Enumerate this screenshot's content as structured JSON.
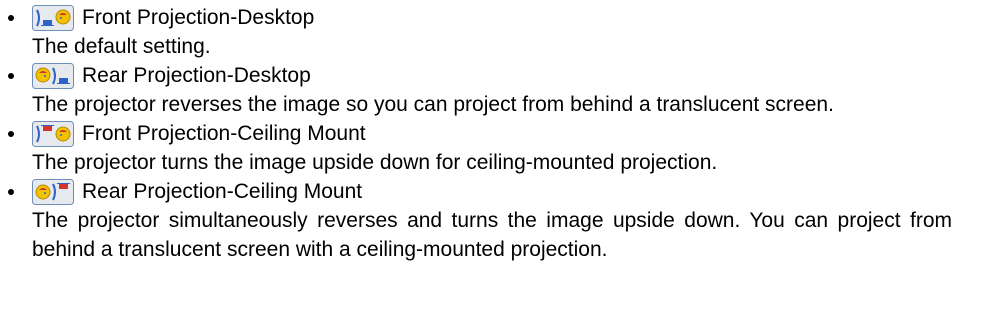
{
  "items": [
    {
      "icon": "front-desktop-icon",
      "title": "Front Projection-Desktop",
      "description": "The default setting."
    },
    {
      "icon": "rear-desktop-icon",
      "title": "Rear Projection-Desktop",
      "description": "The projector reverses the image so you can project from behind a translucent screen."
    },
    {
      "icon": "front-ceiling-icon",
      "title": "Front Projection-Ceiling Mount",
      "description": "The projector turns the image upside down for ceiling-mounted projection."
    },
    {
      "icon": "rear-ceiling-icon",
      "title": "Rear Projection-Ceiling Mount",
      "description": "The projector simultaneously reverses and turns the image upside down. You can project from behind a translucent screen with a ceiling-mounted projection."
    }
  ],
  "colors": {
    "text": "#000000",
    "icon_background": "#e6e9ee",
    "icon_border": "#6f8fb8",
    "icon_yellow": "#f2c200",
    "icon_red": "#d0342c",
    "icon_blue": "#2d63c8"
  }
}
